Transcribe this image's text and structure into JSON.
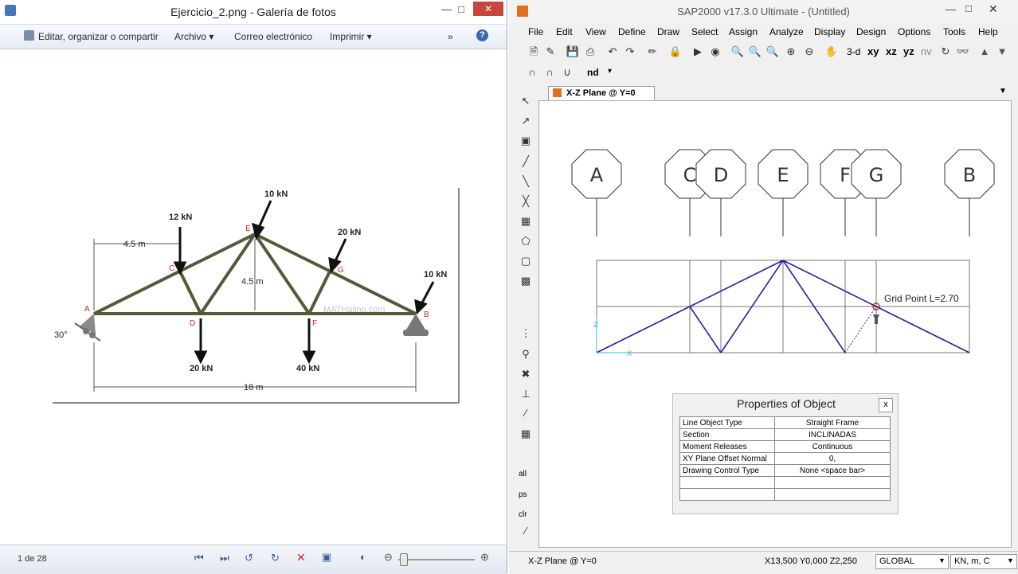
{
  "photo_viewer": {
    "title": "Ejercicio_2.png - Galería de fotos",
    "toolbar": {
      "edit_label": "Editar, organizar o compartir",
      "archivo_label": "Archivo ▾",
      "correo_label": "Correo electrónico",
      "imprimir_label": "Imprimir ▾",
      "more_label": "»"
    },
    "status": {
      "counter": "1 de 28"
    },
    "figure": {
      "loads": {
        "c": "12 kN",
        "e": "10 kN",
        "g": "20 kN",
        "b": "10 kN",
        "d": "20 kN",
        "f": "40 kN"
      },
      "dims": {
        "half_span": "4.5 m",
        "height": "4.5 m",
        "span": "18 m",
        "angle": "30°"
      },
      "nodes": {
        "a": "A",
        "b": "B",
        "c": "C",
        "d": "D",
        "e": "E",
        "f": "F",
        "g": "G"
      },
      "watermark": "MATHalino.com"
    }
  },
  "sap": {
    "title": "SAP2000 v17.3.0 Ultimate - (Untitled)",
    "menu": [
      "File",
      "Edit",
      "View",
      "Define",
      "Draw",
      "Select",
      "Assign",
      "Analyze",
      "Display",
      "Design",
      "Options",
      "Tools",
      "Help"
    ],
    "toolbar_text": {
      "three_d": "3-d",
      "xy": "xy",
      "xz": "xz",
      "yz": "yz",
      "nv": "nv",
      "nd": "nd"
    },
    "sidebar_text": {
      "all": "all",
      "ps": "ps",
      "clr": "clr"
    },
    "tab_label": "X-Z Plane @ Y=0",
    "grid_labels": [
      "A",
      "C",
      "D",
      "E",
      "F",
      "G",
      "B"
    ],
    "grid_point_label": "Grid Point  L=2.70",
    "properties": {
      "title": "Properties of Object",
      "close": "x",
      "rows": [
        {
          "key": "Line Object Type",
          "value": "Straight Frame"
        },
        {
          "key": "Section",
          "value": "INCLINADAS"
        },
        {
          "key": "Moment Releases",
          "value": "Continuous"
        },
        {
          "key": "XY Plane Offset Normal",
          "value": "0,"
        },
        {
          "key": "Drawing Control Type",
          "value": "None  <space bar>"
        }
      ]
    },
    "status": {
      "plane": "X-Z Plane @ Y=0",
      "coords": "X13,500  Y0,000  Z2,250",
      "coord_system": "GLOBAL",
      "units": "KN, m, C"
    }
  },
  "colors": {
    "truss_member": "#525a3a",
    "sap_frame": "#2222aa",
    "node_label": "#cc2222"
  }
}
